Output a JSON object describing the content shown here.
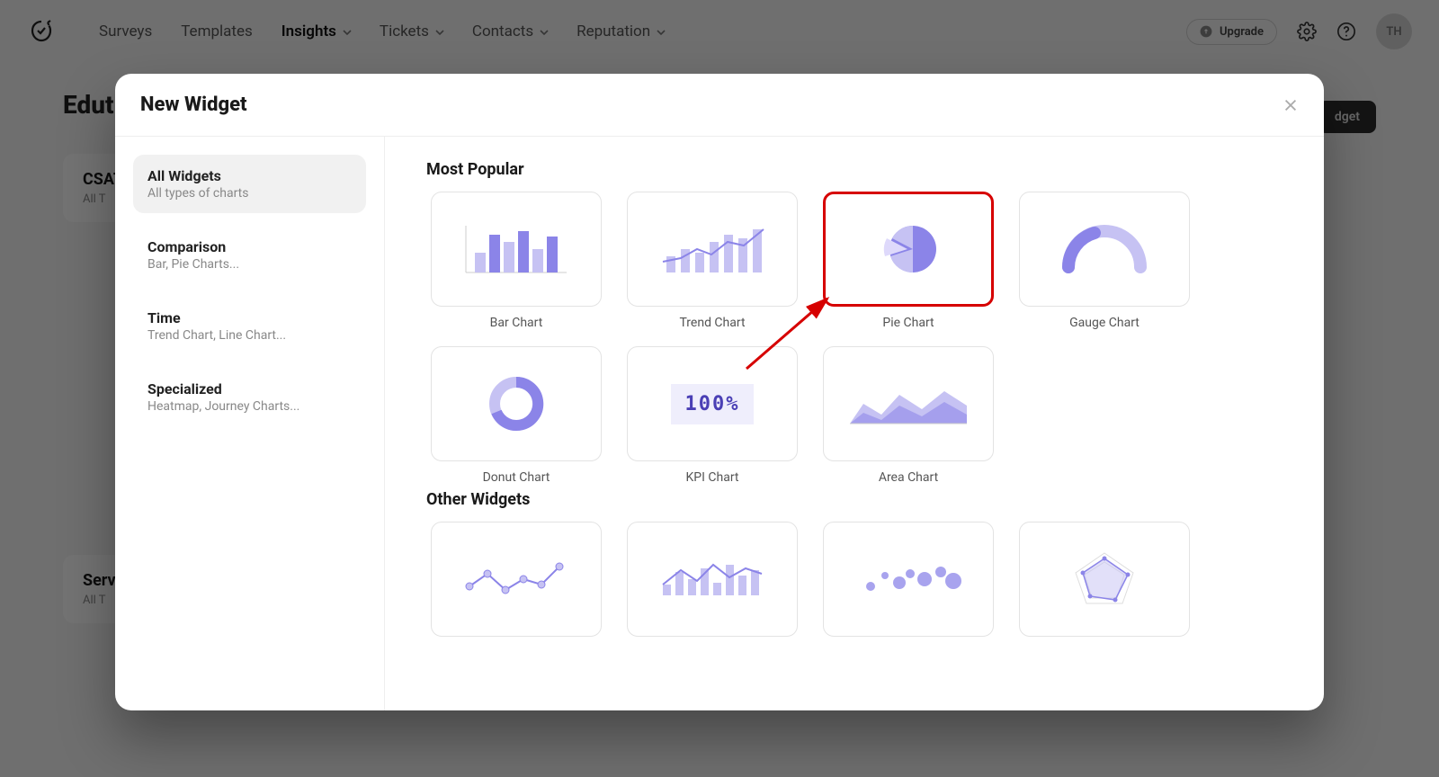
{
  "header": {
    "nav": [
      "Surveys",
      "Templates",
      "Insights",
      "Tickets",
      "Contacts",
      "Reputation"
    ],
    "nav_has_dropdown": [
      false,
      false,
      true,
      true,
      true,
      true
    ],
    "nav_active_index": 2,
    "upgrade_label": "Upgrade",
    "avatar_initials": "TH"
  },
  "page": {
    "title": "Edut",
    "add_widget_label": "dget",
    "cards": [
      {
        "title": "CSAT",
        "sub": "All T"
      },
      {
        "title": "Serv",
        "sub": "All T"
      }
    ]
  },
  "modal": {
    "title": "New Widget",
    "sidebar": [
      {
        "label": "All Widgets",
        "sub": "All types of charts"
      },
      {
        "label": "Comparison",
        "sub": "Bar, Pie Charts..."
      },
      {
        "label": "Time",
        "sub": "Trend Chart, Line Chart..."
      },
      {
        "label": "Specialized",
        "sub": "Heatmap, Journey Charts..."
      }
    ],
    "sidebar_active_index": 0,
    "sections": [
      {
        "title": "Most Popular",
        "widgets": [
          {
            "name": "Bar Chart",
            "icon": "bar"
          },
          {
            "name": "Trend Chart",
            "icon": "trend"
          },
          {
            "name": "Pie Chart",
            "icon": "pie",
            "highlighted": true
          },
          {
            "name": "Gauge Chart",
            "icon": "gauge"
          },
          {
            "name": "Donut Chart",
            "icon": "donut"
          },
          {
            "name": "KPI Chart",
            "icon": "kpi",
            "kpi_text": "100%"
          },
          {
            "name": "Area Chart",
            "icon": "area"
          }
        ]
      },
      {
        "title": "Other Widgets",
        "widgets": [
          {
            "name": "",
            "icon": "line"
          },
          {
            "name": "",
            "icon": "combo"
          },
          {
            "name": "",
            "icon": "bubble"
          },
          {
            "name": "",
            "icon": "radar"
          }
        ]
      }
    ]
  },
  "colors": {
    "accent": "#8b84e8",
    "accent_light": "#c6c2f3",
    "highlight": "#d60000"
  }
}
